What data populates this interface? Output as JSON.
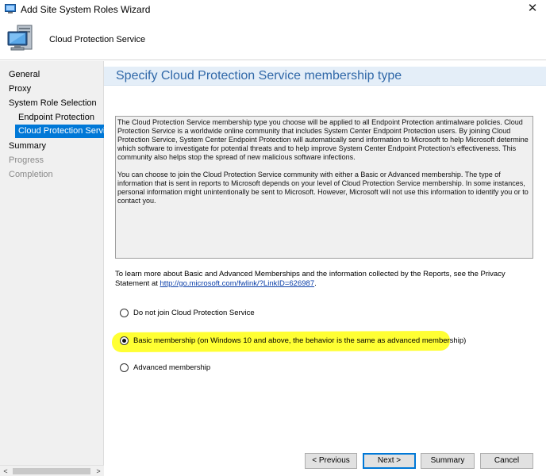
{
  "window": {
    "title": "Add Site System Roles Wizard",
    "close_glyph": "✕",
    "icon": "wizard-app-icon"
  },
  "header": {
    "title": "Cloud Protection Service",
    "icon": "computer-icon"
  },
  "sidebar": {
    "items": [
      {
        "label": "General",
        "state": "normal"
      },
      {
        "label": "Proxy",
        "state": "normal"
      },
      {
        "label": "System Role Selection",
        "state": "normal"
      },
      {
        "label": "Endpoint Protection",
        "state": "normal"
      },
      {
        "label": "Cloud Protection Service",
        "state": "active"
      },
      {
        "label": "Summary",
        "state": "normal"
      },
      {
        "label": "Progress",
        "state": "disabled"
      },
      {
        "label": "Completion",
        "state": "disabled"
      }
    ],
    "scroll_left": "<",
    "scroll_right": ">"
  },
  "main": {
    "title": "Specify Cloud Protection Service membership type",
    "description": [
      "The Cloud Protection Service membership type you choose will be applied to all Endpoint Protection antimalware policies. Cloud Protection Service is a worldwide online community that includes System Center Endpoint Protection users. By joining Cloud Protection Service, System Center Endpoint Protection will automatically send information to Microsoft to help Microsoft determine which software to investigate for potential threats and to help improve System Center Endpoint Protection's effectiveness. This community also helps stop the spread of new malicious software infections.",
      "You can choose to join the Cloud Protection Service community with either a Basic or Advanced membership. The type of information that is sent in reports to Microsoft depends on your level of Cloud Protection Service membership. In some instances, personal information might unintentionally be sent to Microsoft. However, Microsoft will not use this information to identify you or to contact you."
    ],
    "learn_more_text": "To learn more about Basic and Advanced Memberships and the information collected by the Reports, see the Privacy Statement at ",
    "learn_more_link": "http://go.microsoft.com/fwlink/?LinkID=626987",
    "learn_more_end": ".",
    "options": [
      {
        "label": "Do not join Cloud Protection Service",
        "selected": false
      },
      {
        "label": "Basic membership (on Windows 10 and above, the behavior is the same as advanced membership)",
        "selected": true
      },
      {
        "label": "Advanced membership",
        "selected": false
      }
    ],
    "highlight_color": "#ffff33"
  },
  "buttons": {
    "previous": "< Previous",
    "next": "Next >",
    "summary": "Summary",
    "cancel": "Cancel"
  },
  "colors": {
    "accent": "#0078d7",
    "title_text": "#3068a8",
    "link": "#0a3ea8"
  }
}
